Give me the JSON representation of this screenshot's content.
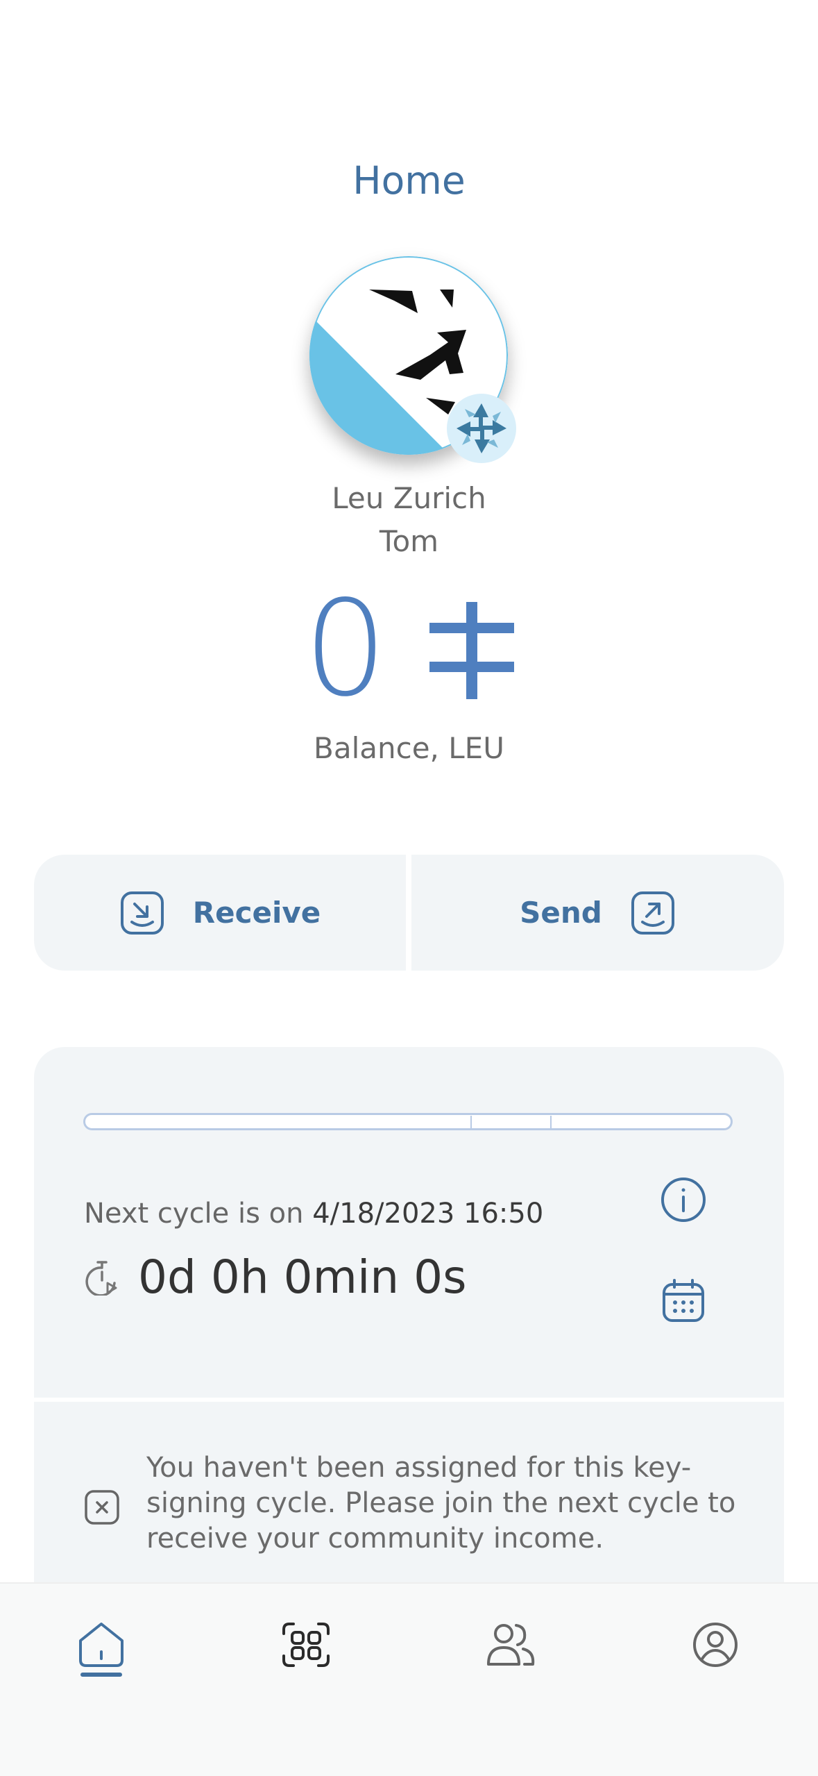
{
  "header": {
    "title": "Home"
  },
  "community": {
    "name": "Leu Zurich",
    "logo_icon": "lion-head-logo",
    "badge_icon": "encointer-arrows-badge"
  },
  "user": {
    "name": "Tom"
  },
  "balance": {
    "value": "0",
    "currency_icon": "leu-currency-symbol",
    "label": "Balance, LEU"
  },
  "actions": {
    "receive_label": "Receive",
    "send_label": "Send"
  },
  "cycle": {
    "next_cycle_prefix": "Next cycle is on",
    "next_cycle_date": "4/18/2023 16:50",
    "countdown": "0d 0h 0min 0s"
  },
  "assignment": {
    "message": "You haven't been assigned for this key-signing cycle. Please join the next cycle to receive your community income."
  },
  "nav": {
    "items": [
      "home",
      "scan",
      "contacts",
      "profile"
    ],
    "active": "home"
  },
  "colors": {
    "accent": "#4271a0",
    "balance": "#4f7fbf",
    "card_bg": "#f2f5f7",
    "logo_blue": "#69c2e6"
  }
}
